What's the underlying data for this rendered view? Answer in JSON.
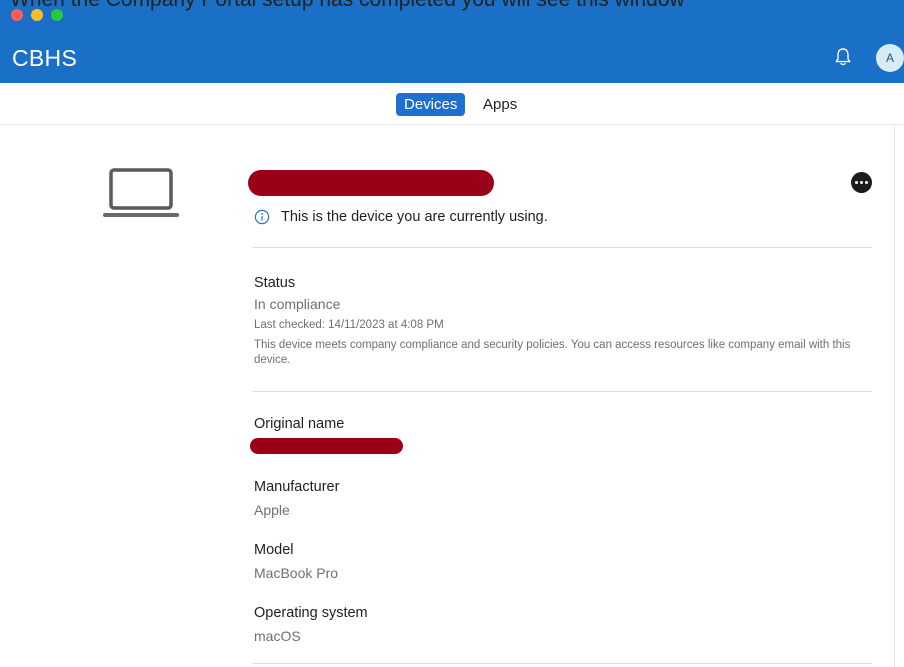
{
  "caption": "When the Company Portal setup has completed you will see this window",
  "window": {
    "title": "CBHS",
    "avatar_initial": "A"
  },
  "tabs": [
    {
      "label": "Devices",
      "selected": true
    },
    {
      "label": "Apps",
      "selected": false
    }
  ],
  "device": {
    "info_message": "This is the device you are currently using.",
    "status": {
      "label": "Status",
      "value": "In compliance",
      "last_checked": "Last checked: 14/11/2023 at 4:08 PM",
      "description": "This device meets company compliance and security policies. You can access resources like company email with this device."
    },
    "original_name": {
      "label": "Original name"
    },
    "manufacturer": {
      "label": "Manufacturer",
      "value": "Apple"
    },
    "model": {
      "label": "Model",
      "value": "MacBook Pro"
    },
    "os": {
      "label": "Operating system",
      "value": "macOS"
    }
  },
  "colors": {
    "titlebar": "#1a70c6",
    "selected_tab": "#1f6fd1",
    "redaction": "#9b0019"
  },
  "icons": {
    "bell": "bell-icon",
    "more": "more-options-icon",
    "info": "info-icon",
    "device": "laptop-icon"
  }
}
